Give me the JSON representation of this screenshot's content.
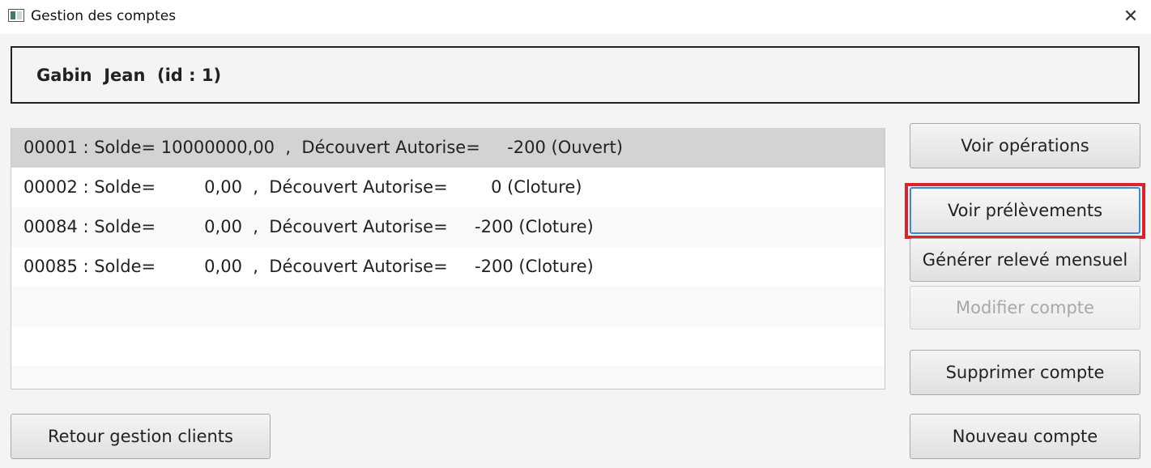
{
  "window": {
    "title": "Gestion des comptes",
    "close_glyph": "✕"
  },
  "client": {
    "header": "Gabin  Jean  (id : 1)"
  },
  "accounts": [
    "00001 : Solde= 10000000,00  ,  Découvert Autorise=     -200 (Ouvert)",
    "00002 : Solde=         0,00  ,  Découvert Autorise=        0 (Cloture)",
    "00084 : Solde=         0,00  ,  Découvert Autorise=     -200 (Cloture)",
    "00085 : Solde=         0,00  ,  Découvert Autorise=     -200 (Cloture)"
  ],
  "buttons": {
    "voir_operations": "Voir opérations",
    "voir_prelevements": "Voir prélèvements",
    "generer_releve": "Générer relevé mensuel",
    "modifier_compte": "Modifier compte",
    "supprimer_compte": "Supprimer compte",
    "nouveau_compte": "Nouveau compte",
    "retour_gestion_clients": "Retour gestion clients"
  },
  "colors": {
    "highlight": "#e0202a",
    "focus": "#3a8ad6",
    "selected_row": "#d3d3d3"
  }
}
